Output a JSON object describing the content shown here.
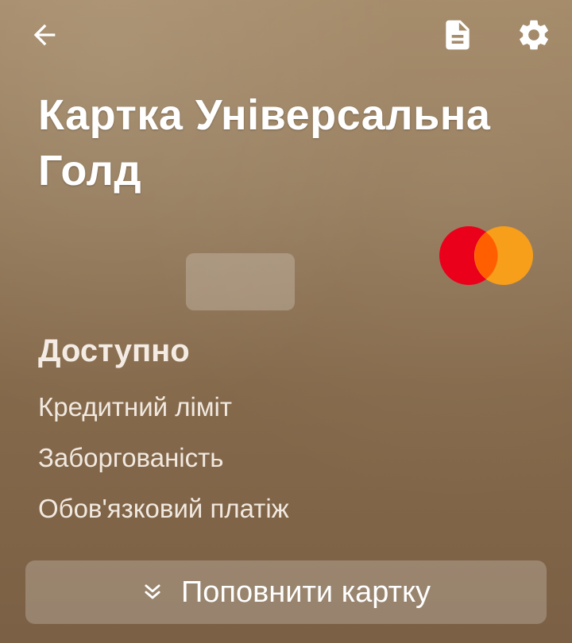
{
  "header": {
    "back_icon": "arrow-left-icon",
    "document_icon": "document-icon",
    "settings_icon": "gear-icon"
  },
  "card": {
    "title": "Картка Універсальна Голд",
    "brand_logo": "mastercard-logo",
    "brand_colors": {
      "red": "#eb001b",
      "orange": "#f79e1b",
      "overlap": "#ff5f00"
    }
  },
  "balance": {
    "available_label": "Доступно"
  },
  "details": {
    "credit_limit_label": "Кредитний ліміт",
    "debt_label": "Заборгованість",
    "mandatory_payment_label": "Обов'язковий платіж"
  },
  "actions": {
    "top_up_label": "Поповнити картку",
    "top_up_icon": "double-chevron-down-icon"
  }
}
